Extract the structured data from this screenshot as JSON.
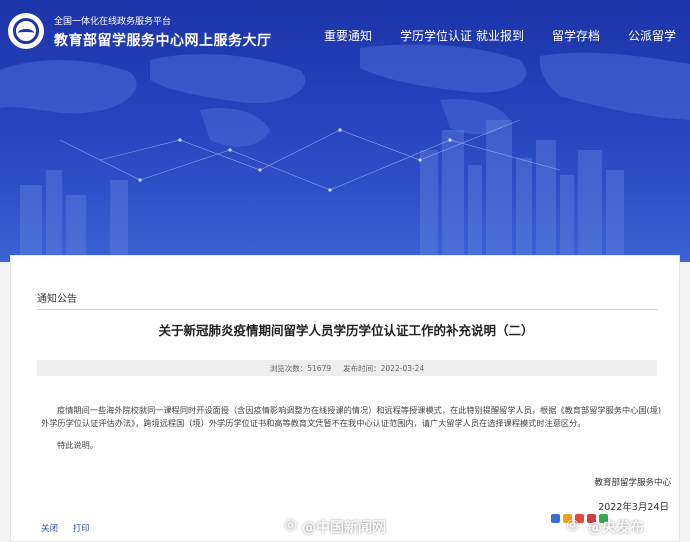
{
  "header": {
    "site_subtitle": "全国一体化在线政务服务平台",
    "site_title": "教育部留学服务中心网上服务大厅",
    "nav": [
      {
        "label": "重要通知"
      },
      {
        "label": "学历学位认证"
      },
      {
        "label": "就业报到"
      },
      {
        "label": "留学存档"
      },
      {
        "label": "公派留学"
      }
    ]
  },
  "breadcrumb": "通知公告",
  "article": {
    "title": "关于新冠肺炎疫情期间留学人员学历学位认证工作的补充说明（二）",
    "views_label": "浏览次数：51679",
    "publish_label": "发布时间：2022-03-24",
    "paragraphs": [
      "疫情期间一些海外院校就同一课程同时开设面授（含因疫情影响调整为在线授课的情况）和远程等授课模式，在此特别提醒留学人员，根据《教育部留学服务中心国(境)外学历学位认证评估办法》，跨境远程国（境）外学历学位证书和高等教育文凭暂不在我中心认证范围内，请广大留学人员在选择课程模式时注意区分。",
      "特此说明。"
    ],
    "signature_org": "教育部留学服务中心",
    "signature_date": "2022年3月24日"
  },
  "footer": {
    "close_label": "关闭",
    "print_label": "打印"
  },
  "watermark": {
    "left_text": "@中国新闻网",
    "right_text": "@央发布"
  },
  "colors": {
    "banner": "#2340b8",
    "link": "#2c4fb0"
  }
}
